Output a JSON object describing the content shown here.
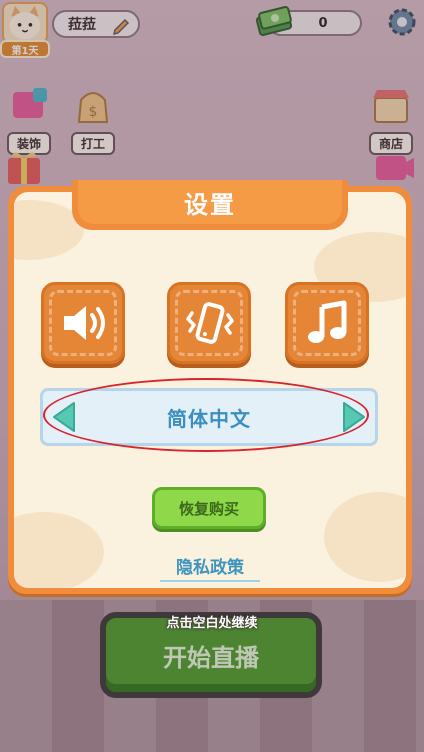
{
  "hud": {
    "player_name": "菈菈",
    "day_badge": "第1天",
    "cash_value": "0"
  },
  "shortcuts": [
    {
      "label": "装饰",
      "icon": "decorate-icon"
    },
    {
      "label": "打工",
      "icon": "work-bag-icon"
    },
    {
      "label": "商店",
      "icon": "shop-icon"
    }
  ],
  "background": {
    "start_button": "开始直播"
  },
  "dialog": {
    "title": "设置",
    "toggles": [
      "sound-icon",
      "vibration-icon",
      "music-icon"
    ],
    "language": "简体中文",
    "restore_button": "恢复购买",
    "privacy_link": "隐私政策"
  },
  "hint": "点击空白处继续",
  "colors": {
    "dialog_orange": "#f08d3c",
    "language_text": "#3a8fc0",
    "arrow_teal": "#56c8b4",
    "restore_green": "#8ed84a",
    "highlight_red": "#d8242c"
  }
}
